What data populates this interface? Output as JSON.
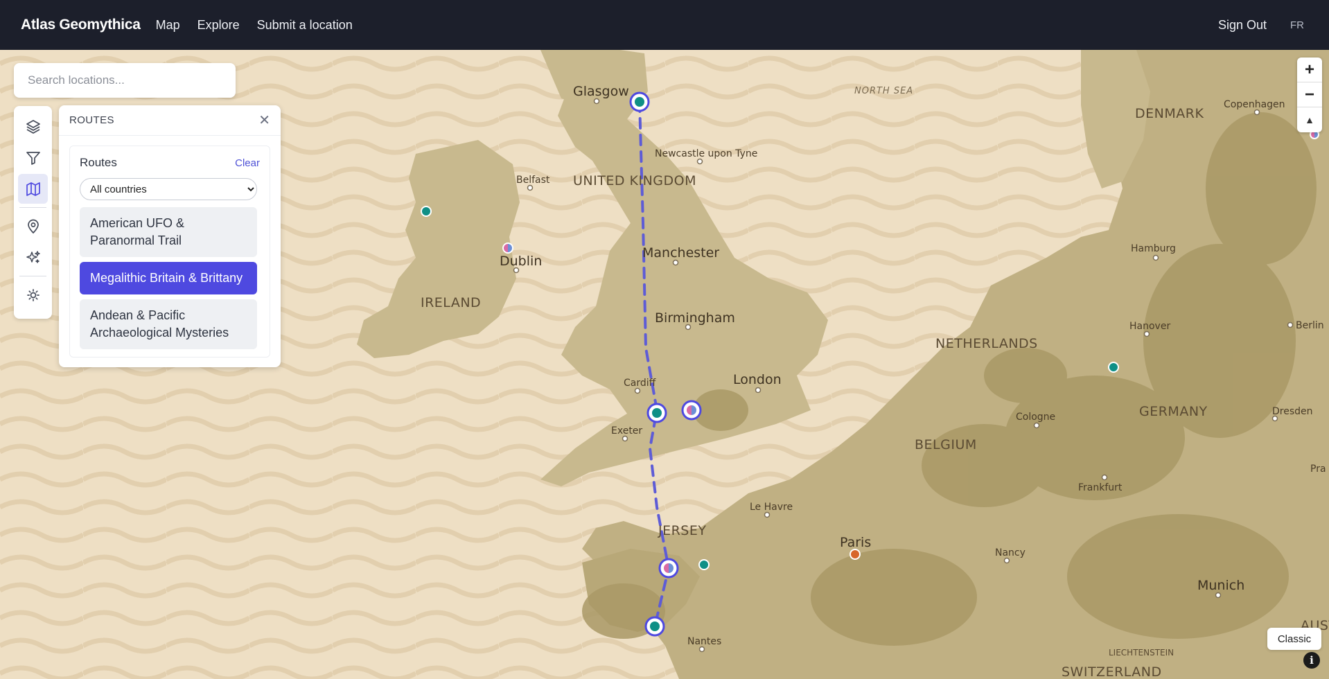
{
  "brand": "Atlas Geomythica",
  "nav": {
    "map": "Map",
    "explore": "Explore",
    "submit": "Submit a location",
    "signout": "Sign Out",
    "lang": "FR"
  },
  "search": {
    "placeholder": "Search locations..."
  },
  "panel": {
    "title": "ROUTES",
    "card_title": "Routes",
    "clear": "Clear",
    "select_value": "All countries",
    "routes": [
      "American UFO & Paranormal Trail",
      "Megalithic Britain & Brittany",
      "Andean & Pacific Archaeological Mysteries"
    ]
  },
  "map_labels": {
    "glasgow": "Glasgow",
    "north_sea": "NORTH SEA",
    "newcastle": "Newcastle upon Tyne",
    "belfast": "Belfast",
    "uk": "UNITED KINGDOM",
    "dublin": "Dublin",
    "ireland": "IRELAND",
    "manchester": "Manchester",
    "birmingham": "Birmingham",
    "london": "London",
    "cardiff": "Cardiff",
    "exeter": "Exeter",
    "jersey": "JERSEY",
    "le_havre": "Le Havre",
    "paris": "Paris",
    "nantes": "Nantes",
    "denmark": "DENMARK",
    "copenhagen": "Copenhagen",
    "hamburg": "Hamburg",
    "hanover": "Hanover",
    "berlin": "Berlin",
    "netherlands": "NETHERLANDS",
    "germany": "GERMANY",
    "cologne": "Cologne",
    "belgium": "BELGIUM",
    "dresden": "Dresden",
    "frankfurt": "Frankfurt",
    "pra": "Pra",
    "nancy": "Nancy",
    "munich": "Munich",
    "liechtenstein": "LIECHTENSTEIN",
    "switzerland": "SWITZERLAND",
    "austria": "AUSTR"
  },
  "controls": {
    "zoom_in": "+",
    "zoom_out": "−",
    "compass": "▲",
    "classic": "Classic",
    "info": "i"
  },
  "colors": {
    "accent": "#4e49e0",
    "route_line": "#5e5cd6",
    "marker_teal": "#0f8f86",
    "marker_orange": "#d7662b",
    "marker_pink": "#d96aa6"
  }
}
